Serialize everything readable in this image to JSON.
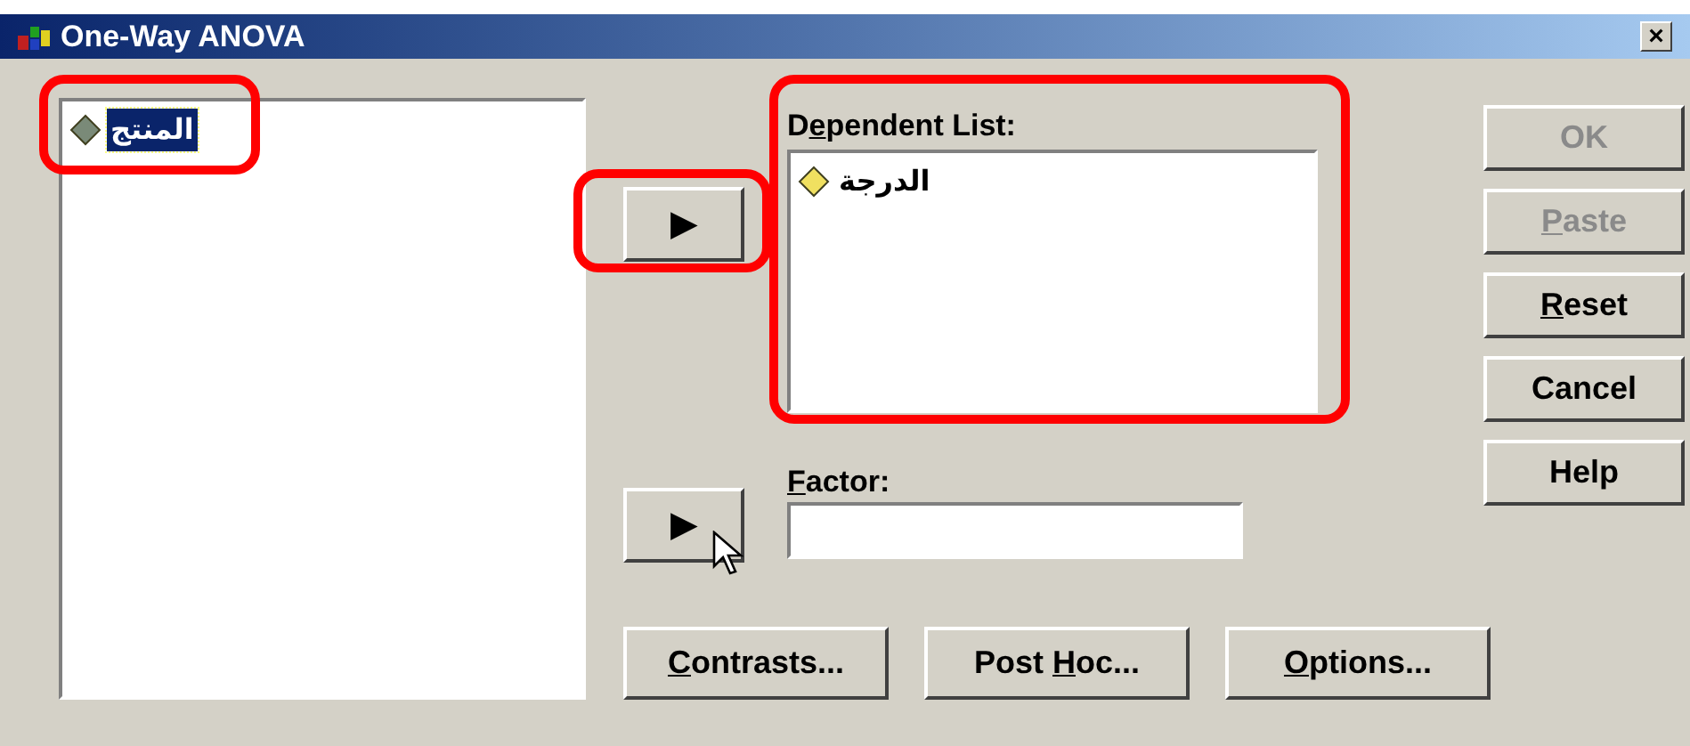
{
  "window": {
    "title": "One-Way ANOVA",
    "close": "×"
  },
  "source_list": {
    "items": [
      {
        "label": "المنتج",
        "kind": "scale",
        "selected": true,
        "highlighted": true
      }
    ]
  },
  "move_buttons": [
    {
      "glyph": "▶",
      "highlighted": true
    },
    {
      "glyph": "▶",
      "highlighted": false
    }
  ],
  "dependent_list": {
    "label_parts": {
      "pre": "D",
      "key": "e",
      "post": "pendent List:"
    },
    "highlighted": true,
    "items": [
      {
        "label": "الدرجة",
        "kind": "scale",
        "selected": false
      }
    ]
  },
  "factor": {
    "label_parts": {
      "key": "F",
      "post": "actor:"
    }
  },
  "bottom_buttons": [
    {
      "label_parts": {
        "key": "C",
        "post": "ontrasts..."
      }
    },
    {
      "label_parts": {
        "pre": "Post ",
        "key": "H",
        "post": "oc..."
      }
    },
    {
      "label_parts": {
        "key": "O",
        "post": "ptions..."
      }
    }
  ],
  "side_buttons": [
    {
      "label_parts": {
        "pre": "OK"
      },
      "disabled": true
    },
    {
      "label_parts": {
        "key": "P",
        "post": "aste"
      },
      "disabled": true
    },
    {
      "label_parts": {
        "key": "R",
        "post": "eset"
      },
      "disabled": false
    },
    {
      "label_parts": {
        "pre": "Cancel"
      },
      "disabled": false
    },
    {
      "label_parts": {
        "pre": "Help"
      },
      "disabled": false
    }
  ]
}
